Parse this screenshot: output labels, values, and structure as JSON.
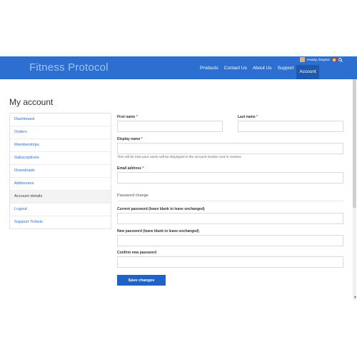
{
  "header": {
    "brand": "Fitness Protocol",
    "nav": [
      "Products",
      "Contact Us",
      "About Us",
      "Support",
      "Account"
    ],
    "active_nav": "Account",
    "user_name": "Howdy, fangtraz",
    "accent_color": "#2d6fd1"
  },
  "page": {
    "title": "My account"
  },
  "sidebar": {
    "items": [
      {
        "label": "Dashboard"
      },
      {
        "label": "Orders"
      },
      {
        "label": "Memberships"
      },
      {
        "label": "Subscriptions"
      },
      {
        "label": "Downloads"
      },
      {
        "label": "Addresses"
      },
      {
        "label": "Account details"
      },
      {
        "label": "Logout"
      },
      {
        "label": "Support Tickets"
      }
    ],
    "current": "Account details"
  },
  "form": {
    "first_name_label": "First name",
    "last_name_label": "Last name",
    "display_name_label": "Display name",
    "display_name_hint": "This will be how your name will be displayed in the account section and in reviews",
    "email_label": "Email address",
    "password_section": "Password change",
    "current_password_label": "Current password (leave blank to leave unchanged)",
    "new_password_label": "New password (leave blank to leave unchanged)",
    "confirm_password_label": "Confirm new password",
    "required_mark": "*",
    "save_label": "Save changes"
  }
}
